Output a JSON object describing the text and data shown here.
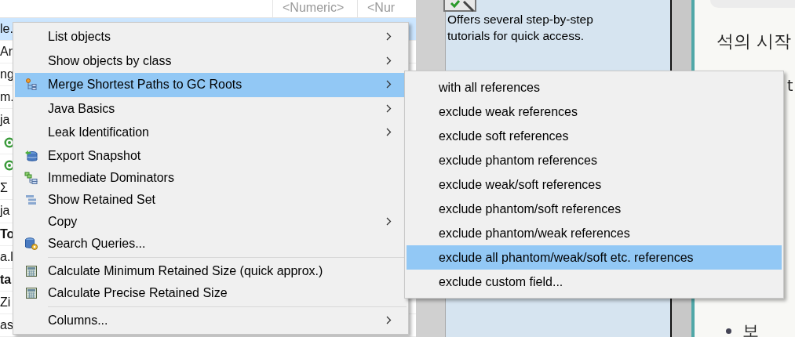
{
  "table": {
    "columns": [
      "<Numeric>",
      "<Nur"
    ],
    "rows": [
      {
        "cell": "le.",
        "selected": true,
        "kind": "text"
      },
      {
        "cell": "Ar",
        "selected": false,
        "kind": "text"
      },
      {
        "cell": "ng",
        "selected": false,
        "kind": "text"
      },
      {
        "cell": "m.",
        "selected": false,
        "kind": "text"
      },
      {
        "cell": "ja",
        "selected": false,
        "kind": "text"
      },
      {
        "selected": false,
        "kind": "class"
      },
      {
        "selected": false,
        "kind": "class"
      },
      {
        "cell": "Σ",
        "selected": false,
        "kind": "text"
      },
      {
        "cell": "ja",
        "selected": false,
        "kind": "text"
      },
      {
        "cell": "To",
        "selected": false,
        "kind": "bold"
      },
      {
        "cell": "a.l",
        "selected": false,
        "kind": "text"
      },
      {
        "cell": "ta",
        "selected": false,
        "kind": "bold"
      },
      {
        "cell": "Zi",
        "selected": false,
        "kind": "text"
      },
      {
        "cell": "as",
        "selected": false,
        "kind": "text"
      }
    ]
  },
  "help_panel": {
    "description": "Offers several step-by-step tutorials for quick access."
  },
  "document": {
    "heading": "석의 시작",
    "fragments": [
      "t"
    ],
    "bullet": "보"
  },
  "context_menu": {
    "items": [
      {
        "label": "List objects",
        "kind": "plain",
        "submenu": true,
        "selected": false,
        "separator_before": false
      },
      {
        "label": "Show objects by class",
        "kind": "plain",
        "submenu": true,
        "selected": false,
        "separator_before": false
      },
      {
        "label": "Merge Shortest Paths to GC Roots",
        "kind": "paths",
        "submenu": true,
        "selected": true,
        "separator_before": false
      },
      {
        "label": "Java Basics",
        "kind": "plain",
        "submenu": true,
        "selected": false,
        "separator_before": false
      },
      {
        "label": "Leak Identification",
        "kind": "plain",
        "submenu": true,
        "selected": false,
        "separator_before": false
      },
      {
        "label": "Export Snapshot",
        "kind": "export",
        "submenu": false,
        "selected": false,
        "separator_before": false
      },
      {
        "label": "Immediate Dominators",
        "kind": "dominators",
        "submenu": false,
        "selected": false,
        "separator_before": false
      },
      {
        "label": "Show Retained Set",
        "kind": "retained",
        "submenu": false,
        "selected": false,
        "separator_before": false
      },
      {
        "label": "Copy",
        "kind": "plain",
        "submenu": true,
        "selected": false,
        "separator_before": false
      },
      {
        "label": "Search Queries...",
        "kind": "queries",
        "submenu": false,
        "selected": false,
        "separator_before": false
      },
      {
        "label": "Calculate Minimum Retained Size (quick approx.)",
        "kind": "calc",
        "submenu": false,
        "selected": false,
        "separator_before": true
      },
      {
        "label": "Calculate Precise Retained Size",
        "kind": "calc",
        "submenu": false,
        "selected": false,
        "separator_before": false
      },
      {
        "label": "Columns...",
        "kind": "plain",
        "submenu": true,
        "selected": false,
        "separator_before": true
      }
    ]
  },
  "submenu": {
    "items": [
      {
        "label": "with all references",
        "selected": false
      },
      {
        "label": "exclude weak references",
        "selected": false
      },
      {
        "label": "exclude soft references",
        "selected": false
      },
      {
        "label": "exclude phantom references",
        "selected": false
      },
      {
        "label": "exclude weak/soft references",
        "selected": false
      },
      {
        "label": "exclude phantom/soft references",
        "selected": false
      },
      {
        "label": "exclude phantom/weak references",
        "selected": false
      },
      {
        "label": "exclude all phantom/weak/soft etc. references",
        "selected": true
      },
      {
        "label": "exclude custom field...",
        "selected": false
      }
    ]
  }
}
